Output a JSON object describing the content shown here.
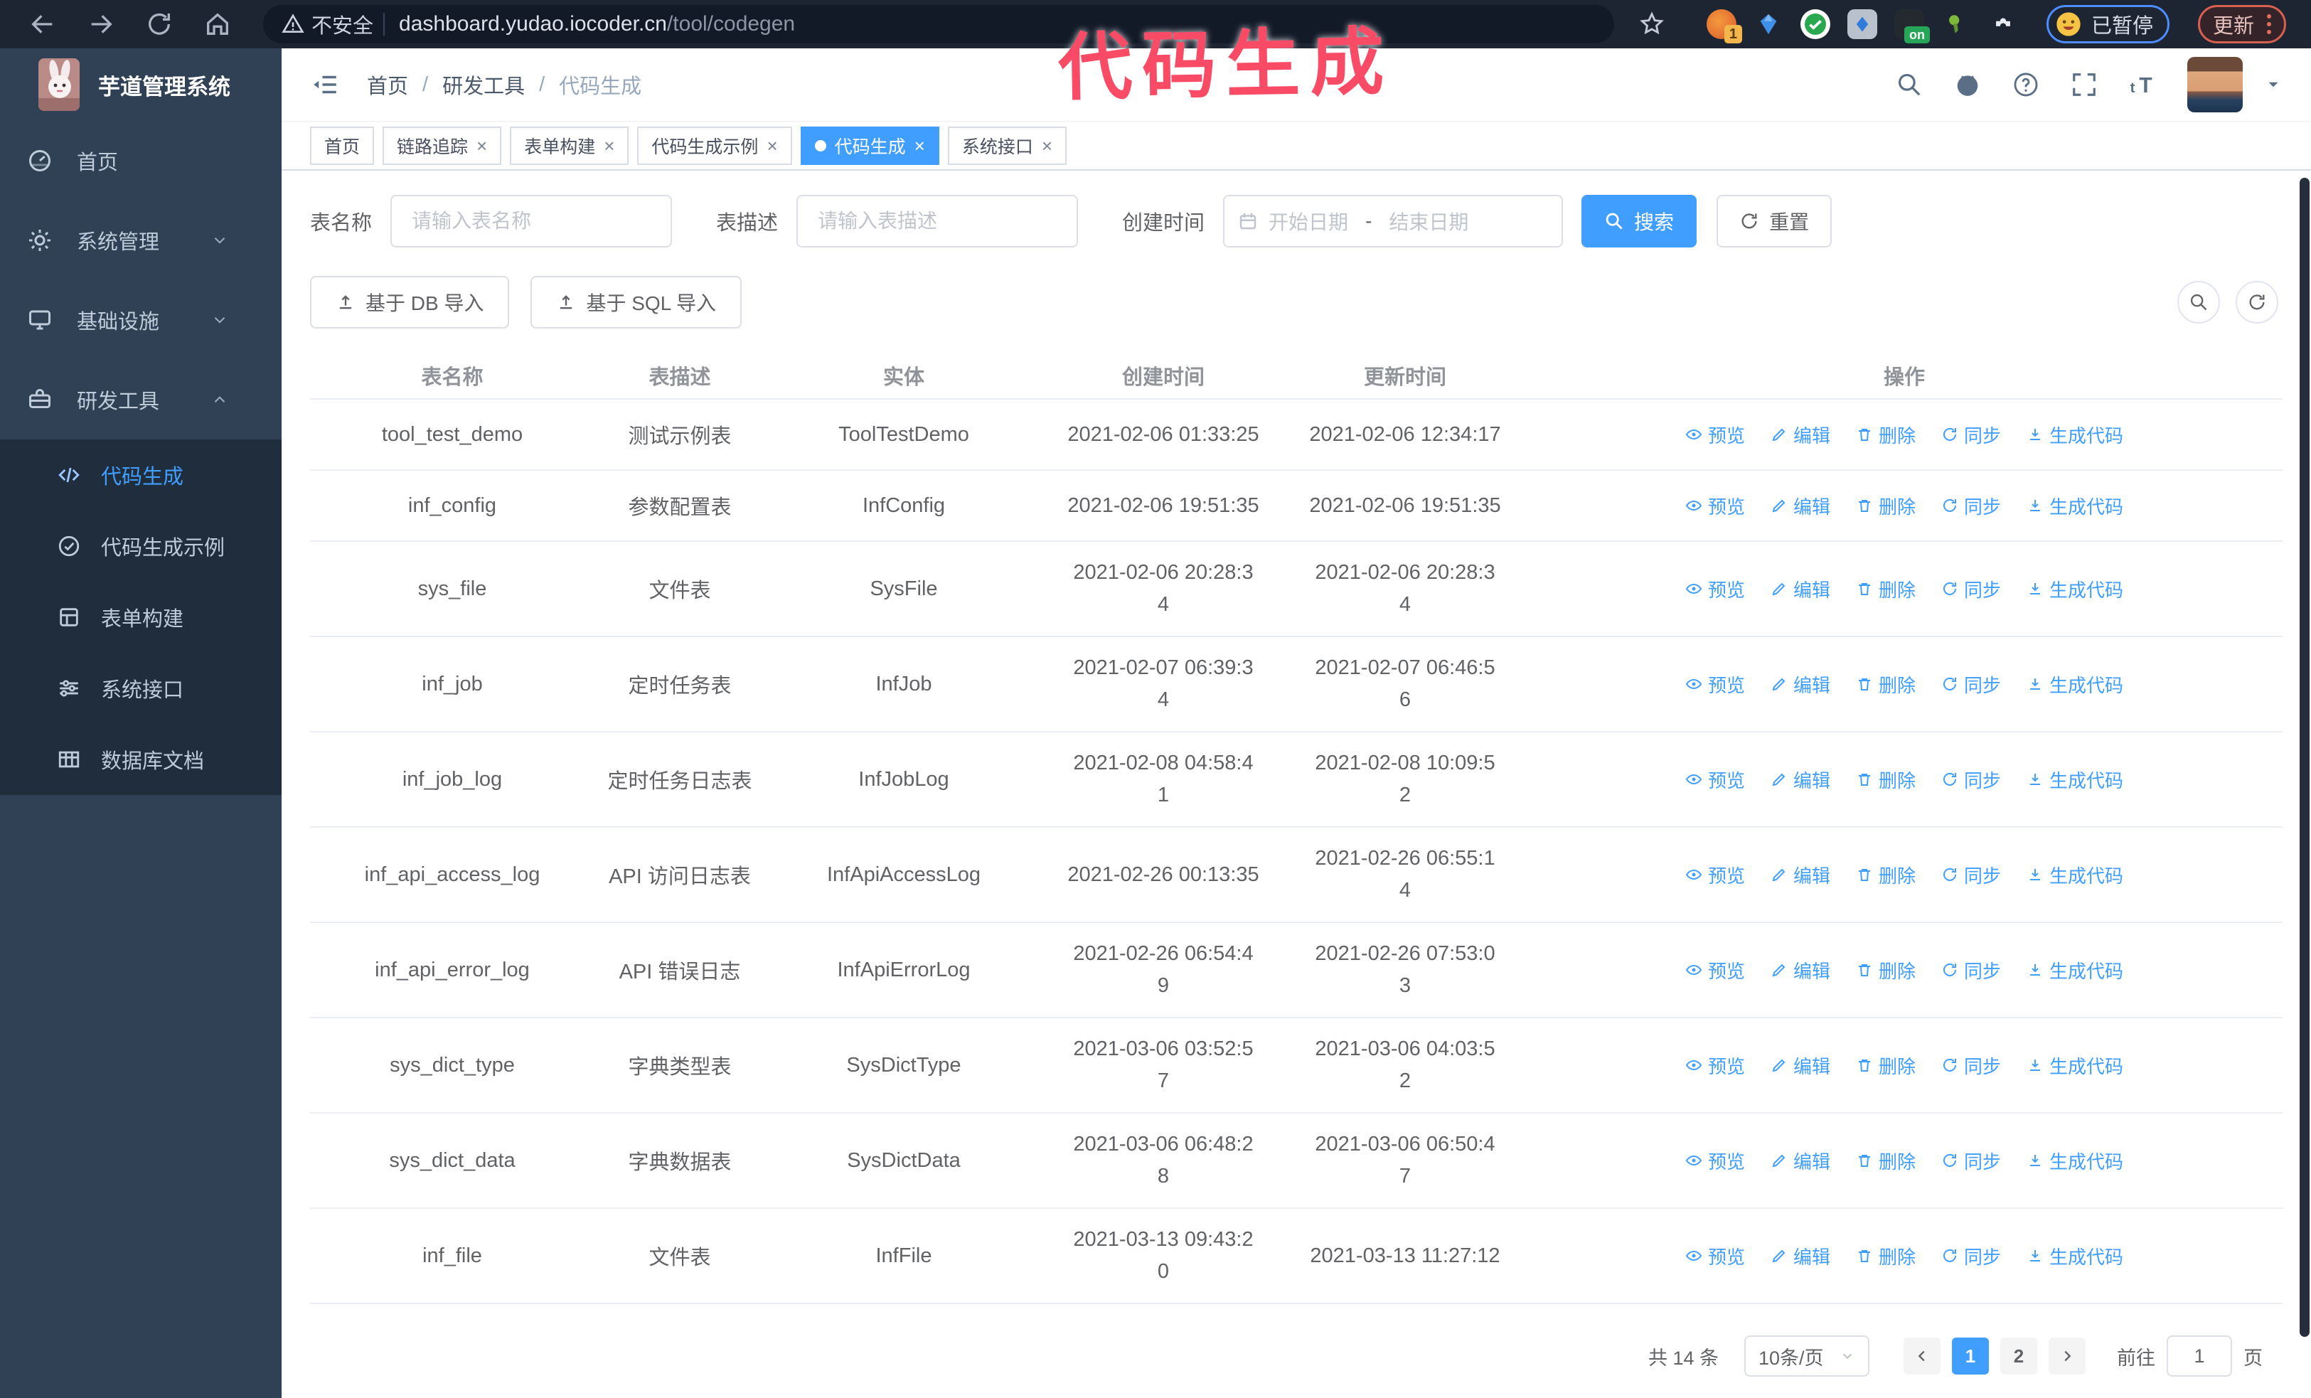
{
  "browser": {
    "security_text": "不安全",
    "url_domain": "dashboard.yudao.iocoder.cn",
    "url_path": "/tool/codegen",
    "ext_badge_count": "1",
    "ext_badge_on": "on",
    "paused_text": "已暂停",
    "update_text": "更新"
  },
  "annotation": {
    "text": "代码生成",
    "color": "#f94b66"
  },
  "sidebar": {
    "logo_title": "芋道管理系统",
    "items": [
      {
        "label": "首页",
        "icon": "dashboard",
        "chevron": null
      },
      {
        "label": "系统管理",
        "icon": "gear",
        "chevron": "down"
      },
      {
        "label": "基础设施",
        "icon": "monitor",
        "chevron": "down"
      },
      {
        "label": "研发工具",
        "icon": "toolbox",
        "chevron": "up"
      }
    ],
    "submenu": [
      {
        "label": "代码生成",
        "icon": "code",
        "active": true
      },
      {
        "label": "代码生成示例",
        "icon": "check-circle",
        "active": false
      },
      {
        "label": "表单构建",
        "icon": "form",
        "active": false
      },
      {
        "label": "系统接口",
        "icon": "sliders",
        "active": false
      },
      {
        "label": "数据库文档",
        "icon": "grid",
        "active": false
      }
    ]
  },
  "header": {
    "breadcrumb": [
      "首页",
      "研发工具",
      "代码生成"
    ],
    "separator": "/"
  },
  "tabs": [
    {
      "label": "首页",
      "closable": false,
      "active": false
    },
    {
      "label": "链路追踪",
      "closable": true,
      "active": false
    },
    {
      "label": "表单构建",
      "closable": true,
      "active": false
    },
    {
      "label": "代码生成示例",
      "closable": true,
      "active": false
    },
    {
      "label": "代码生成",
      "closable": true,
      "active": true
    },
    {
      "label": "系统接口",
      "closable": true,
      "active": false
    }
  ],
  "ui": {
    "close_glyph": "×"
  },
  "filters": {
    "name_label": "表名称",
    "name_placeholder": "请输入表名称",
    "desc_label": "表描述",
    "desc_placeholder": "请输入表描述",
    "time_label": "创建时间",
    "start_placeholder": "开始日期",
    "range_separator": "-",
    "end_placeholder": "结束日期",
    "search_label": "搜索",
    "reset_label": "重置"
  },
  "toolbar": {
    "import_db_label": "基于 DB 导入",
    "import_sql_label": "基于 SQL 导入"
  },
  "table": {
    "columns": [
      "表名称",
      "表描述",
      "实体",
      "创建时间",
      "更新时间",
      "操作"
    ],
    "actions": [
      {
        "key": "preview",
        "icon": "eye",
        "label": "预览"
      },
      {
        "key": "edit",
        "icon": "pencil",
        "label": "编辑"
      },
      {
        "key": "delete",
        "icon": "trash",
        "label": "删除"
      },
      {
        "key": "sync",
        "icon": "sync",
        "label": "同步"
      },
      {
        "key": "generate",
        "icon": "download",
        "label": "生成代码"
      }
    ],
    "rows": [
      {
        "name": "tool_test_demo",
        "desc": "测试示例表",
        "entity": "ToolTestDemo",
        "created": [
          "2021-02-06 01:33:25"
        ],
        "updated": [
          "2021-02-06 12:34:17"
        ]
      },
      {
        "name": "inf_config",
        "desc": "参数配置表",
        "entity": "InfConfig",
        "created": [
          "2021-02-06 19:51:35"
        ],
        "updated": [
          "2021-02-06 19:51:35"
        ]
      },
      {
        "name": "sys_file",
        "desc": "文件表",
        "entity": "SysFile",
        "created": [
          "2021-02-06 20:28:3",
          "4"
        ],
        "updated": [
          "2021-02-06 20:28:3",
          "4"
        ]
      },
      {
        "name": "inf_job",
        "desc": "定时任务表",
        "entity": "InfJob",
        "created": [
          "2021-02-07 06:39:3",
          "4"
        ],
        "updated": [
          "2021-02-07 06:46:5",
          "6"
        ]
      },
      {
        "name": "inf_job_log",
        "desc": "定时任务日志表",
        "entity": "InfJobLog",
        "created": [
          "2021-02-08 04:58:4",
          "1"
        ],
        "updated": [
          "2021-02-08 10:09:5",
          "2"
        ]
      },
      {
        "name": "inf_api_access_log",
        "desc": "API 访问日志表",
        "entity": "InfApiAccessLog",
        "created": [
          "2021-02-26 00:13:35"
        ],
        "updated": [
          "2021-02-26 06:55:1",
          "4"
        ]
      },
      {
        "name": "inf_api_error_log",
        "desc": "API 错误日志",
        "entity": "InfApiErrorLog",
        "created": [
          "2021-02-26 06:54:4",
          "9"
        ],
        "updated": [
          "2021-02-26 07:53:0",
          "3"
        ]
      },
      {
        "name": "sys_dict_type",
        "desc": "字典类型表",
        "entity": "SysDictType",
        "created": [
          "2021-03-06 03:52:5",
          "7"
        ],
        "updated": [
          "2021-03-06 04:03:5",
          "2"
        ]
      },
      {
        "name": "sys_dict_data",
        "desc": "字典数据表",
        "entity": "SysDictData",
        "created": [
          "2021-03-06 06:48:2",
          "8"
        ],
        "updated": [
          "2021-03-06 06:50:4",
          "7"
        ]
      },
      {
        "name": "inf_file",
        "desc": "文件表",
        "entity": "InfFile",
        "created": [
          "2021-03-13 09:43:2",
          "0"
        ],
        "updated": [
          "2021-03-13 11:27:12"
        ]
      }
    ]
  },
  "pagination": {
    "total_text": "共 14 条",
    "page_size_text": "10条/页",
    "pages": [
      "1",
      "2"
    ],
    "active_page": "1",
    "goto_label": "前往",
    "goto_value": "1",
    "unit_label": "页"
  }
}
